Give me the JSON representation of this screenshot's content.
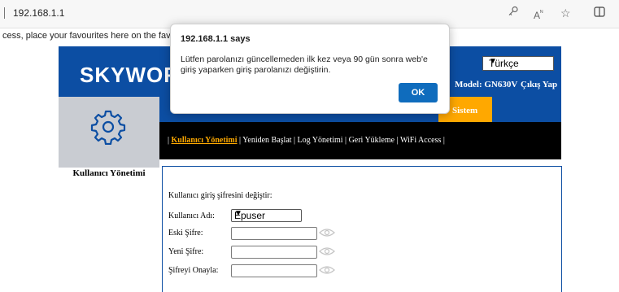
{
  "browser": {
    "url": "192.168.1.1",
    "favourites_text": "cess, place your favourites here on the favourite",
    "icons": [
      "key-icon",
      "read-aloud-icon",
      "favorite-star-icon",
      "split-screen-icon"
    ]
  },
  "router": {
    "logo": "SKYWOR",
    "language": "Türkçe",
    "model": "Model: GN630V",
    "logout": "Çıkış Yap",
    "active_tab": "Sistem",
    "submenu": {
      "selected": "Kullanıcı Yönetimi",
      "rest": "| Yeniden Başlat | Log Yönetimi | Geri Yükleme | WiFi Access |"
    },
    "side_label": "Kullanıcı Yönetimi",
    "form": {
      "title": "Kullanıcı giriş şifresini değiştir:",
      "username_label": "Kullanıcı Adı:",
      "username_value": "Epuser",
      "old_password_label": "Eski Şifre:",
      "new_password_label": "Yeni Şifre:",
      "confirm_label": "Şifreyi Onayla:"
    }
  },
  "dialog": {
    "title": "192.168.1.1 says",
    "message": "Lütfen parolanızı güncellemeden ilk kez veya 90 gün sonra web'e giriş yaparken giriş parolanızı değiştirin.",
    "ok_label": "OK"
  },
  "colors": {
    "header_blue": "#0c4ea3",
    "active_tab_orange": "#ffa800",
    "submenu_black": "#000000",
    "side_gray": "#c9ccd2",
    "ok_blue": "#0f6cbd"
  }
}
